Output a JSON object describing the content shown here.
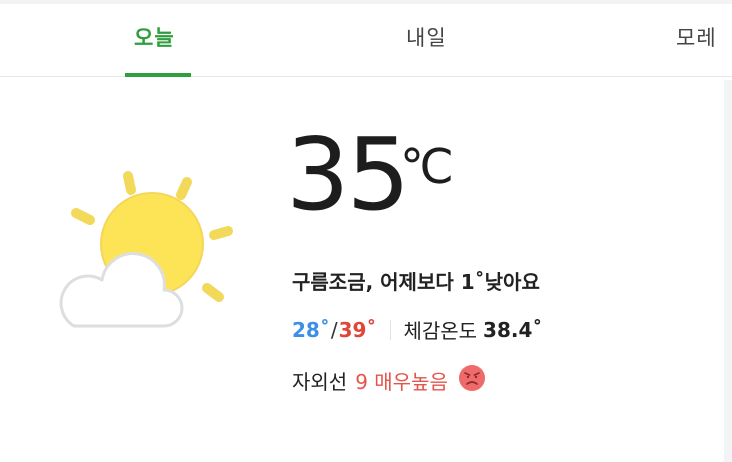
{
  "tabs": [
    {
      "label": "오늘"
    },
    {
      "label": "내일"
    },
    {
      "label": "모레"
    }
  ],
  "weather": {
    "icon": "partly-cloudy-icon",
    "temperature": "35",
    "unit": "℃",
    "summary": "구름조금, 어제보다 1˚낮아요",
    "min": "28˚",
    "slash": "/",
    "max": "39˚",
    "feels_label": "체감온도",
    "feels_value": "38.4˚",
    "uv_label": "자외선",
    "uv_value": "9 매우높음",
    "uv_icon": "angry-face-icon"
  },
  "colors": {
    "accent": "#2f9e3f",
    "min_temp": "#3b8fe8",
    "max_temp": "#e04537",
    "uv_warning": "#e5544b"
  }
}
